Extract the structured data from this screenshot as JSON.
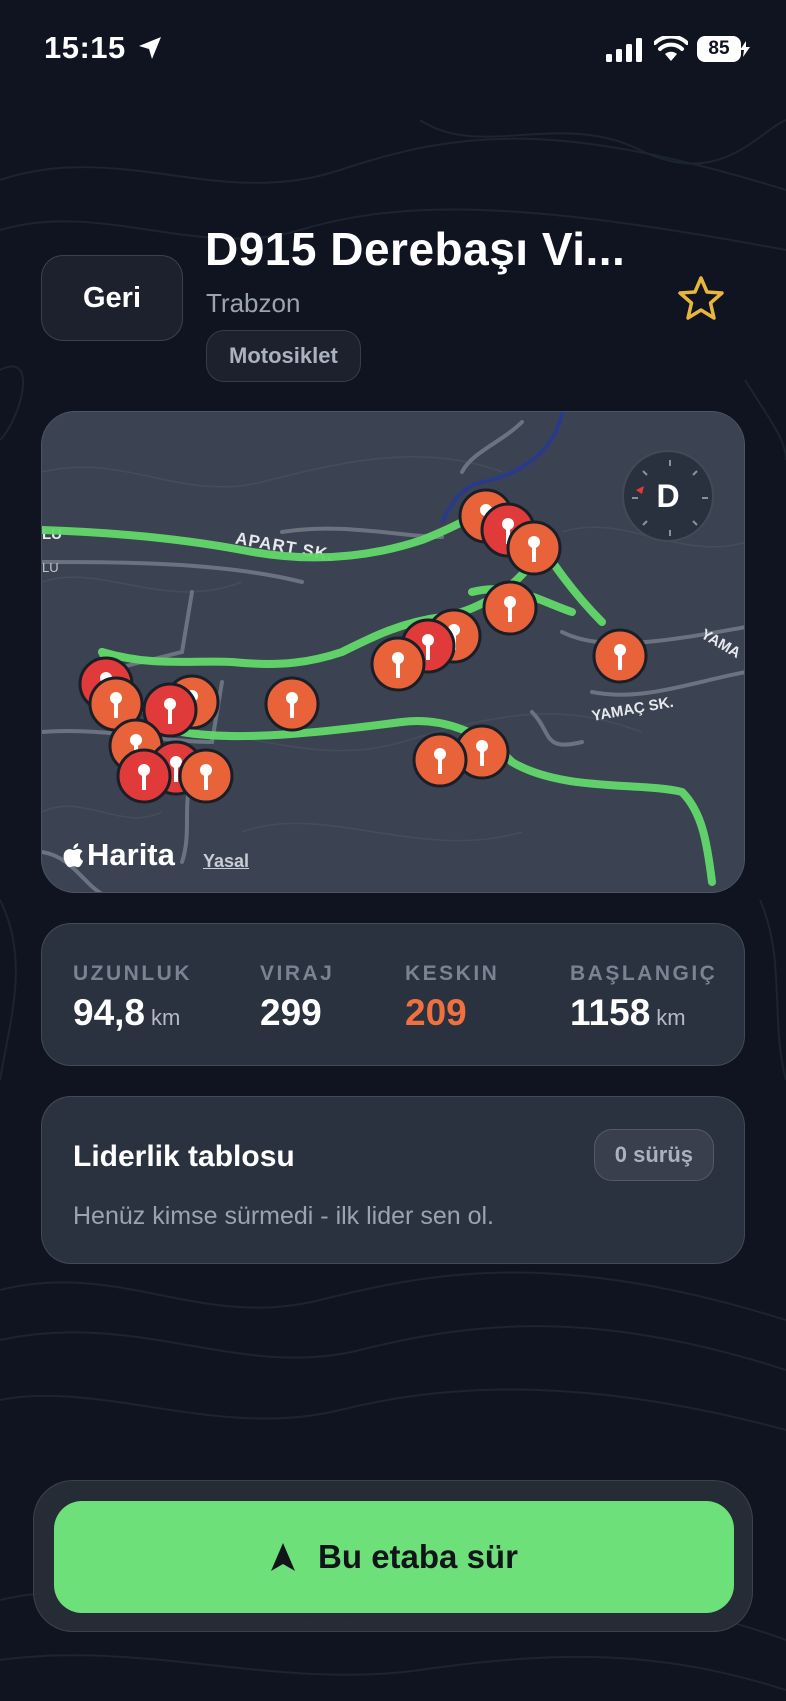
{
  "status_bar": {
    "time": "15:15",
    "battery": "85",
    "icons": [
      "location-arrow-icon",
      "cellular-signal-icon",
      "wifi-icon",
      "battery-icon"
    ]
  },
  "header": {
    "back_label": "Geri",
    "title": "D915 Derebaşı Vi...",
    "subtitle": "Trabzon",
    "tag": "Motosiklet",
    "favorite_icon": "star-outline-icon"
  },
  "map": {
    "streets": [
      "APART SK.",
      "YAMAÇ SK.",
      "YAMA",
      "LU"
    ],
    "compass_label": "D",
    "provider": "Harita",
    "legal": "Yasal",
    "route_color": "#62d96b",
    "pin_colors": [
      "#e8623a",
      "#e03a3a"
    ]
  },
  "stats": [
    {
      "label": "UZUNLUK",
      "value": "94,8",
      "unit": "km"
    },
    {
      "label": "VIRAJ",
      "value": "299",
      "unit": ""
    },
    {
      "label": "KESKIN",
      "value": "209",
      "unit": ""
    },
    {
      "label": "BAŞLANGIÇ",
      "value": "1158",
      "unit": "km"
    }
  ],
  "leaderboard": {
    "title": "Liderlik tablosu",
    "count": "0 sürüş",
    "empty_text": "Henüz kimse sürmedi - ilk lider sen ol."
  },
  "cta": {
    "label": "Bu etaba sür",
    "icon": "navigation-arrow-icon"
  },
  "colors": {
    "background": "#0f1420",
    "accent_orange": "#f0713f",
    "primary_green": "#6ee07a",
    "star_gold": "#e8b63c"
  }
}
